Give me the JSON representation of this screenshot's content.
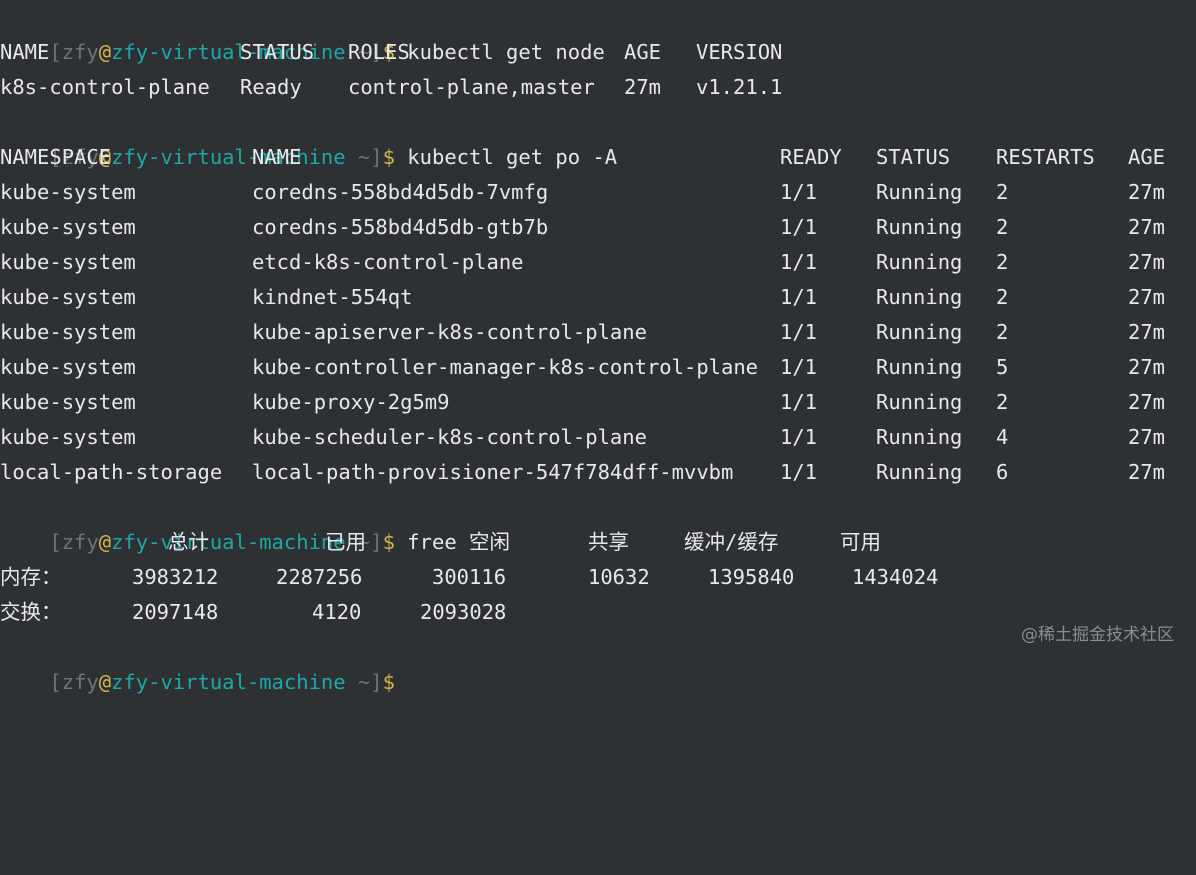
{
  "prompt": {
    "open": "[",
    "user": "zfy",
    "at": "@",
    "host": "zfy-virtual-machine",
    "path": " ~",
    "close": "]",
    "dollar": "$"
  },
  "commands": {
    "get_node": " kubectl get node",
    "get_pods": " kubectl get po -A",
    "free": " free"
  },
  "nodes": {
    "headers": [
      "NAME",
      "STATUS",
      "ROLES",
      "AGE",
      "VERSION"
    ],
    "rows": [
      [
        "k8s-control-plane",
        "Ready",
        "control-plane,master",
        "27m",
        "v1.21.1"
      ]
    ]
  },
  "pods": {
    "headers": [
      "NAMESPACE",
      "NAME",
      "READY",
      "STATUS",
      "RESTARTS",
      "AGE"
    ],
    "rows": [
      [
        "kube-system",
        "coredns-558bd4d5db-7vmfg",
        "1/1",
        "Running",
        "2",
        "27m"
      ],
      [
        "kube-system",
        "coredns-558bd4d5db-gtb7b",
        "1/1",
        "Running",
        "2",
        "27m"
      ],
      [
        "kube-system",
        "etcd-k8s-control-plane",
        "1/1",
        "Running",
        "2",
        "27m"
      ],
      [
        "kube-system",
        "kindnet-554qt",
        "1/1",
        "Running",
        "2",
        "27m"
      ],
      [
        "kube-system",
        "kube-apiserver-k8s-control-plane",
        "1/1",
        "Running",
        "2",
        "27m"
      ],
      [
        "kube-system",
        "kube-controller-manager-k8s-control-plane",
        "1/1",
        "Running",
        "5",
        "27m"
      ],
      [
        "kube-system",
        "kube-proxy-2g5m9",
        "1/1",
        "Running",
        "2",
        "27m"
      ],
      [
        "kube-system",
        "kube-scheduler-k8s-control-plane",
        "1/1",
        "Running",
        "4",
        "27m"
      ],
      [
        "local-path-storage",
        "local-path-provisioner-547f784dff-mvvbm",
        "1/1",
        "Running",
        "6",
        "27m"
      ]
    ]
  },
  "free": {
    "headers": [
      "总计",
      "已用",
      "空闲",
      "共享",
      "缓冲/缓存",
      "可用"
    ],
    "rows": [
      [
        "内存：",
        "3983212",
        "2287256",
        "300116",
        "10632",
        "1395840",
        "1434024"
      ],
      [
        "交换：",
        "2097148",
        "4120",
        "2093028"
      ]
    ]
  },
  "watermark": "@稀土掘金技术社区"
}
